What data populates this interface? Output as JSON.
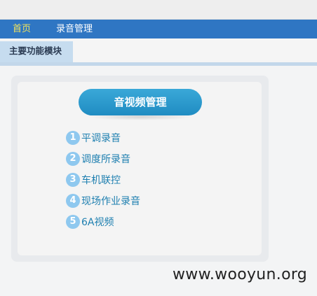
{
  "nav": {
    "items": [
      {
        "label": "首页",
        "active": true
      },
      {
        "label": "录音管理",
        "active": false
      }
    ]
  },
  "tab": {
    "label": "主要功能模块"
  },
  "module": {
    "title": "音视频管理",
    "items": [
      {
        "number": "1",
        "label": "平调录音"
      },
      {
        "number": "2",
        "label": "调度所录音"
      },
      {
        "number": "3",
        "label": "车机联控"
      },
      {
        "number": "4",
        "label": "现场作业录音"
      },
      {
        "number": "5",
        "label": "6A视频"
      }
    ]
  },
  "watermark": "www.wooyun.org",
  "colors": {
    "nav_bg": "#2f76c3",
    "nav_active": "#f2e35c",
    "pill": "#2a9bd0",
    "badge": "#8ec8ef",
    "link": "#1e7fb0"
  }
}
